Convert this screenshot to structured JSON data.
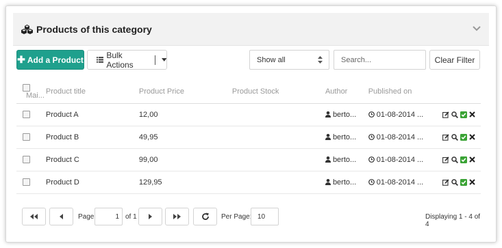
{
  "header": {
    "title": "Products of this category",
    "icon": "cubes-icon"
  },
  "toolbar": {
    "add_label": "Add a Product",
    "bulk_label": "Bulk Actions",
    "filter_selected": "Show all",
    "search_placeholder": "Search...",
    "clear_label": "Clear Filter",
    "accent_color": "#1fa08d"
  },
  "table": {
    "columns": [
      "Mai...",
      "Product title",
      "Product Price",
      "Product Stock",
      "Author",
      "Published on"
    ],
    "rows": [
      {
        "title": "Product A",
        "price": "12,00",
        "stock": "",
        "author": "berto...",
        "published": "01-08-2014 ..."
      },
      {
        "title": "Product B",
        "price": "49,95",
        "stock": "",
        "author": "berto...",
        "published": "01-08-2014 ..."
      },
      {
        "title": "Product C",
        "price": "99,00",
        "stock": "",
        "author": "berto...",
        "published": "01-08-2014 ..."
      },
      {
        "title": "Product D",
        "price": "129,95",
        "stock": "",
        "author": "berto...",
        "published": "01-08-2014 ..."
      }
    ]
  },
  "pager": {
    "page_label": "Page",
    "page_value": "1",
    "of_label": "of 1",
    "per_page_label": "Per Page:",
    "per_page_value": "10",
    "displaying": "Displaying 1 - 4 of 4"
  }
}
